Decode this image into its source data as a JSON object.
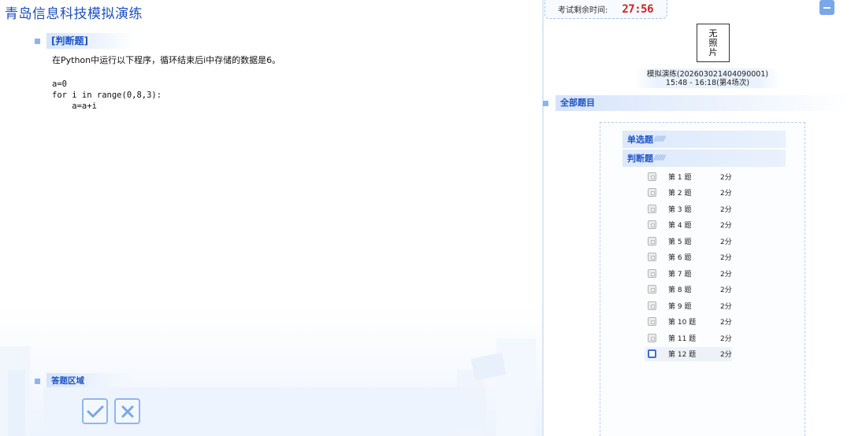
{
  "app": {
    "title": "青岛信息科技模拟演练"
  },
  "question": {
    "section": "[判断题]",
    "text": "在Python中运行以下程序，循环结束后i中存储的数据是6。",
    "code": [
      "a=0",
      "for i in range(0,8,3):",
      "    a=a+i"
    ]
  },
  "answer": {
    "section": "答题区域",
    "true_icon": "check-icon",
    "false_icon": "cross-icon"
  },
  "sidebar": {
    "timer_label": "考试剩余时间:",
    "timer_value": "27:56",
    "photo_text": "无照片",
    "exam_line1": "模拟演练(202603021404090001)",
    "exam_line2": "15:48 - 16:18(第4场次)",
    "all_questions": "全部题目",
    "types": [
      {
        "label": "单选题",
        "deco": "//////"
      },
      {
        "label": "判断题",
        "deco": "//////"
      }
    ],
    "items": [
      {
        "title": "第 1 题",
        "score": "2分"
      },
      {
        "title": "第 2 题",
        "score": "2分"
      },
      {
        "title": "第 3 题",
        "score": "2分"
      },
      {
        "title": "第 4 题",
        "score": "2分"
      },
      {
        "title": "第 5 题",
        "score": "2分"
      },
      {
        "title": "第 6 题",
        "score": "2分"
      },
      {
        "title": "第 7 题",
        "score": "2分"
      },
      {
        "title": "第 8 题",
        "score": "2分"
      },
      {
        "title": "第 9 题",
        "score": "2分"
      },
      {
        "title": "第 10 题",
        "score": "2分"
      },
      {
        "title": "第 11 题",
        "score": "2分"
      },
      {
        "title": "第 12 题",
        "score": "2分"
      }
    ],
    "current_index": 11
  },
  "colors": {
    "accent": "#1f55c7",
    "timer": "#d42323",
    "panel": "#eef4fd"
  }
}
